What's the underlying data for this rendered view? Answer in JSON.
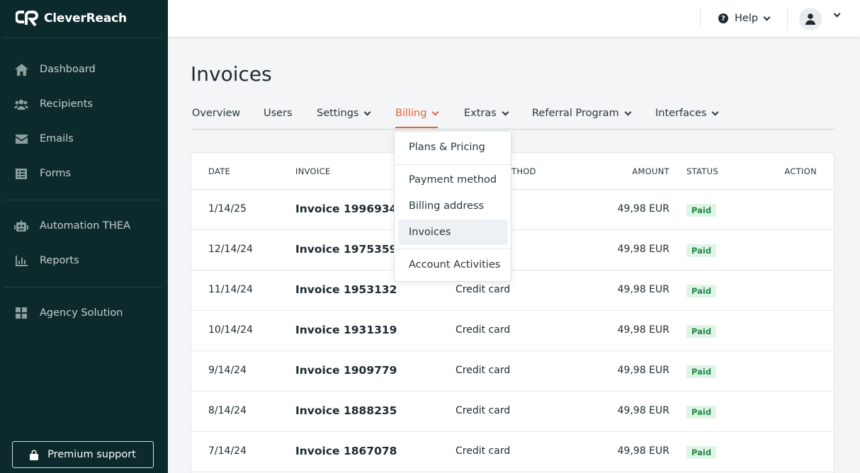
{
  "brand": {
    "name": "CleverReach"
  },
  "sidebar": {
    "items": [
      {
        "label": "Dashboard",
        "icon": "home-icon"
      },
      {
        "label": "Recipients",
        "icon": "users-icon"
      },
      {
        "label": "Emails",
        "icon": "envelope-icon"
      },
      {
        "label": "Forms",
        "icon": "form-icon"
      },
      {
        "label": "Automation THEA",
        "icon": "robot-icon"
      },
      {
        "label": "Reports",
        "icon": "bar-chart-icon"
      },
      {
        "label": "Agency Solution",
        "icon": "grid-icon"
      }
    ],
    "premium_label": "Premium support"
  },
  "topbar": {
    "help_label": "Help"
  },
  "page": {
    "title": "Invoices"
  },
  "tabs": [
    {
      "label": "Overview",
      "has_menu": false
    },
    {
      "label": "Users",
      "has_menu": false
    },
    {
      "label": "Settings",
      "has_menu": true
    },
    {
      "label": "Billing",
      "has_menu": true,
      "active": true
    },
    {
      "label": "Extras",
      "has_menu": true
    },
    {
      "label": "Referral Program",
      "has_menu": true
    },
    {
      "label": "Interfaces",
      "has_menu": true
    }
  ],
  "billing_menu": {
    "items": [
      "Plans & Pricing",
      "Payment method",
      "Billing address",
      "Invoices",
      "Account Activities"
    ],
    "selected": "Invoices"
  },
  "table": {
    "headers": {
      "date": "DATE",
      "invoice": "INVOICE",
      "method": "THOD",
      "amount": "AMOUNT",
      "status": "STATUS",
      "action": "ACTION"
    },
    "rows": [
      {
        "date": "1/14/25",
        "invoice": "Invoice 1996934",
        "method": "",
        "amount": "49,98 EUR",
        "status": "Paid"
      },
      {
        "date": "12/14/24",
        "invoice": "Invoice 1975359",
        "method": "",
        "amount": "49,98 EUR",
        "status": "Paid"
      },
      {
        "date": "11/14/24",
        "invoice": "Invoice 1953132",
        "method": "Credit card",
        "amount": "49,98 EUR",
        "status": "Paid"
      },
      {
        "date": "10/14/24",
        "invoice": "Invoice 1931319",
        "method": "Credit card",
        "amount": "49,98 EUR",
        "status": "Paid"
      },
      {
        "date": "9/14/24",
        "invoice": "Invoice 1909779",
        "method": "Credit card",
        "amount": "49,98 EUR",
        "status": "Paid"
      },
      {
        "date": "8/14/24",
        "invoice": "Invoice 1888235",
        "method": "Credit card",
        "amount": "49,98 EUR",
        "status": "Paid"
      },
      {
        "date": "7/14/24",
        "invoice": "Invoice 1867078",
        "method": "Credit card",
        "amount": "49,98 EUR",
        "status": "Paid"
      }
    ]
  },
  "colors": {
    "sidebar_bg": "#0c2a2c",
    "accent": "#e8623e",
    "paid_bg": "#dff4e6",
    "paid_text": "#1e8a48"
  }
}
